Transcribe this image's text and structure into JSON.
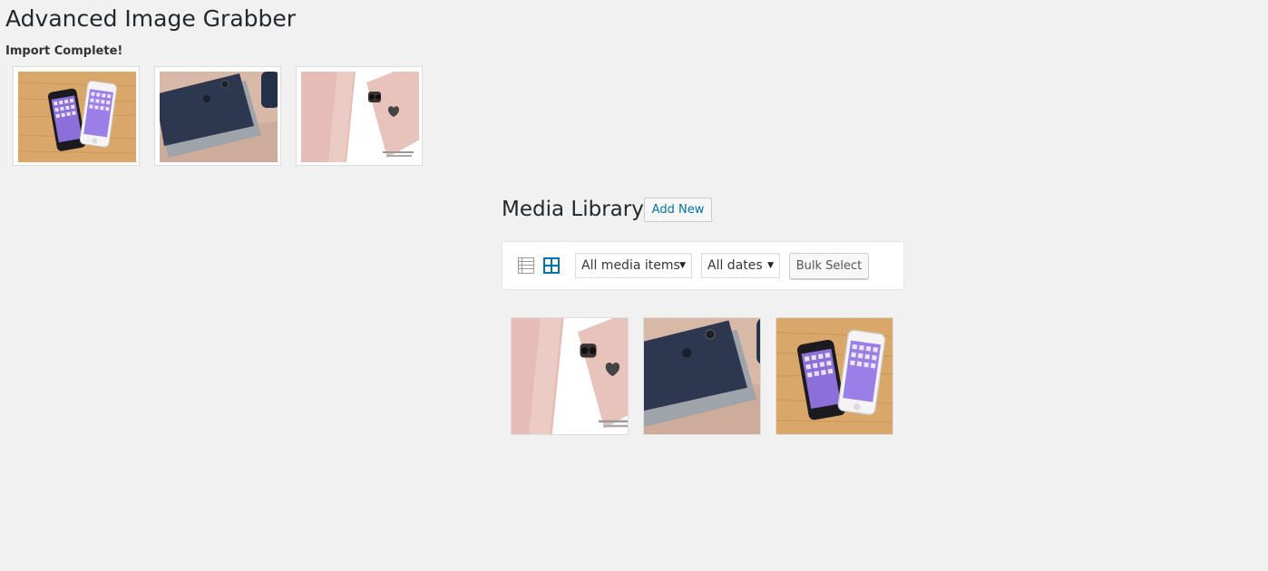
{
  "plugin": {
    "title": "Advanced Image Grabber",
    "status": "Import Complete!"
  },
  "imported_images": [
    {
      "subject": "two-iphones-on-wood",
      "icon": "photo-iphones-wood"
    },
    {
      "subject": "blue-and-silver-iphones",
      "icon": "photo-iphones-blue"
    },
    {
      "subject": "rose-gold-iphone",
      "icon": "photo-iphone-rose"
    }
  ],
  "media_library": {
    "title": "Media Library",
    "add_new_label": "Add New",
    "toolbar": {
      "list_view_icon": "list-view-icon",
      "grid_view_icon": "grid-view-icon",
      "type_filter_selected": "All media items",
      "date_filter_selected": "All dates",
      "bulk_select_label": "Bulk Select"
    },
    "items": [
      {
        "subject": "rose-gold-iphone",
        "icon": "photo-iphone-rose"
      },
      {
        "subject": "blue-and-silver-iphones",
        "icon": "photo-iphones-blue"
      },
      {
        "subject": "two-iphones-on-wood",
        "icon": "photo-iphones-wood"
      }
    ]
  },
  "colors": {
    "page_background": "#f1f1f1",
    "link_blue": "#0073aa",
    "text_dark": "#23282d",
    "border": "#dddddd"
  }
}
